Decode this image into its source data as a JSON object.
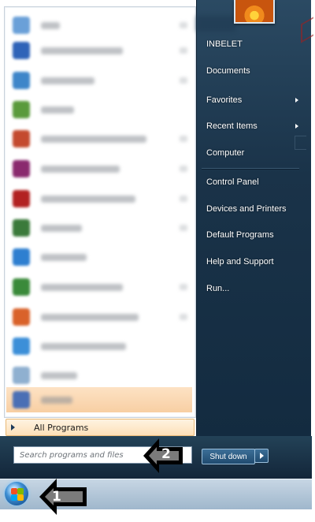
{
  "start_menu": {
    "programs_blurred": [
      {
        "icon_color": "#6aa0d8"
      },
      {
        "icon_color": "#2f63b8"
      },
      {
        "icon_color": "#3e86c9"
      },
      {
        "icon_color": "#5a9a3c"
      },
      {
        "icon_color": "#c44a2f"
      },
      {
        "icon_color": "#8a2a6e"
      },
      {
        "icon_color": "#b22222"
      },
      {
        "icon_color": "#3b7a3b"
      },
      {
        "icon_color": "#2e7fd0"
      },
      {
        "icon_color": "#3a8a3a"
      },
      {
        "icon_color": "#d9622a"
      },
      {
        "icon_color": "#3c8fd8"
      },
      {
        "icon_color": "#8fb0d0"
      },
      {
        "icon_color": "#4a6fb5"
      }
    ],
    "all_programs_label": "All Programs",
    "search_placeholder": "Search programs and files",
    "right_items": {
      "user": "INBELET",
      "documents": "Documents",
      "favorites": "Favorites",
      "recent_items": "Recent Items",
      "computer": "Computer",
      "control_panel": "Control Panel",
      "devices_printers": "Devices and Printers",
      "default_programs": "Default Programs",
      "help_support": "Help and Support",
      "run": "Run..."
    },
    "shutdown_label": "Shut down"
  },
  "callouts": {
    "one": "1",
    "two": "2"
  },
  "colors": {
    "right_panel": "#1a3349",
    "highlight": "#f8cfa3"
  }
}
